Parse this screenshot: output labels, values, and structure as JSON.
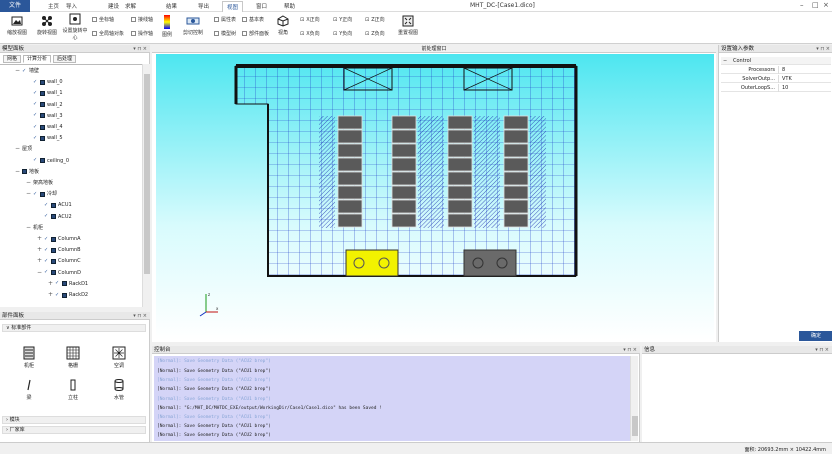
{
  "menu": {
    "file": "文件",
    "items": [
      "主页",
      "导入",
      "建设",
      "求解",
      "结果",
      "导出",
      "视图",
      "窗口",
      "帮助"
    ],
    "active_index": 6,
    "window_title": "MHT_DC-[Case1.dico]"
  },
  "ribbon": {
    "buttons": [
      "缩放视图",
      "旋转视图",
      "设置旋转中心",
      "图例",
      "剪切控制",
      "视角",
      "重置视图"
    ],
    "checks": [
      "坐标轴",
      "接线轴",
      "操作轴",
      "全局轴对象",
      "属性表",
      "基本表",
      "模型树",
      "部件面板"
    ],
    "views": [
      "X正向",
      "Y正向",
      "Z正向",
      "X负向",
      "Y负向",
      "Z负向"
    ]
  },
  "left_panel": {
    "title": "模型面板",
    "tabs": [
      "网格",
      "计算分析",
      "后处理"
    ],
    "tree": [
      {
        "label": "墙壁",
        "level": 1,
        "toggle": "−",
        "check": true,
        "icon": false
      },
      {
        "label": "wall_0",
        "level": 2,
        "toggle": "",
        "check": true,
        "icon": true
      },
      {
        "label": "wall_1",
        "level": 2,
        "toggle": "",
        "check": true,
        "icon": true
      },
      {
        "label": "wall_2",
        "level": 2,
        "toggle": "",
        "check": true,
        "icon": true
      },
      {
        "label": "wall_3",
        "level": 2,
        "toggle": "",
        "check": true,
        "icon": true
      },
      {
        "label": "wall_4",
        "level": 2,
        "toggle": "",
        "check": true,
        "icon": true
      },
      {
        "label": "wall_5",
        "level": 2,
        "toggle": "",
        "check": true,
        "icon": true
      },
      {
        "label": "屋顶",
        "level": 1,
        "toggle": "−",
        "check": false,
        "icon": false
      },
      {
        "label": "ceiling_0",
        "level": 2,
        "toggle": "",
        "check": true,
        "icon": true
      },
      {
        "label": "地板",
        "level": 1,
        "toggle": "−",
        "check": false,
        "icon": true
      },
      {
        "label": "架高地板",
        "level": 2,
        "toggle": "−",
        "check": false,
        "icon": false
      },
      {
        "label": "冷却",
        "level": 2,
        "toggle": "−",
        "check": true,
        "icon": true
      },
      {
        "label": "ACU1",
        "level": 3,
        "toggle": "",
        "check": true,
        "icon": true
      },
      {
        "label": "ACU2",
        "level": 3,
        "toggle": "",
        "check": true,
        "icon": true
      },
      {
        "label": "机柜",
        "level": 2,
        "toggle": "−",
        "check": false,
        "icon": false
      },
      {
        "label": "ColumnA",
        "level": 3,
        "toggle": "+",
        "check": true,
        "icon": true
      },
      {
        "label": "ColumnB",
        "level": 3,
        "toggle": "+",
        "check": true,
        "icon": true
      },
      {
        "label": "ColumnC",
        "level": 3,
        "toggle": "+",
        "check": true,
        "icon": true
      },
      {
        "label": "ColumnD",
        "level": 3,
        "toggle": "−",
        "check": true,
        "icon": true
      },
      {
        "label": "RackD1",
        "level": 4,
        "toggle": "+",
        "check": true,
        "icon": true
      },
      {
        "label": "RackD2",
        "level": 4,
        "toggle": "+",
        "check": true,
        "icon": true
      }
    ]
  },
  "part_panel": {
    "title": "部件面板",
    "section": "标准部件",
    "parts": [
      "机柜",
      "格栅",
      "空调",
      "梁",
      "立柱",
      "水管"
    ],
    "section2": "模块",
    "section3": "厂家库"
  },
  "viewport": {
    "title": "前处理窗口"
  },
  "right_panel": {
    "title": "设置输入参数",
    "group": "Control",
    "rows": [
      {
        "k": "Processors",
        "v": "8"
      },
      {
        "k": "SolverOutp...",
        "v": "VTK"
      },
      {
        "k": "OuterLoopS...",
        "v": "10"
      }
    ],
    "confirm": "确定"
  },
  "console": {
    "title": "控制台",
    "lines": [
      "[Normal]: Save Geometry Data (\"ACU1 brep\")",
      "[Normal]: Save Geometry Data (\"ACU2 brep\")",
      "[Normal]: \"G:/MHT_DC/MHTDC_EXE/output/WorkingDir/Case1/Case1.dico\" has been Saved !",
      "[Normal]: Save Geometry Data (\"ACU1 brep\")",
      "[Normal]: Save Geometry Data (\"ACU2 brep\")"
    ]
  },
  "info_panel": {
    "title": "信息"
  },
  "status": {
    "text": "面积: 20693.2mm × 10422.4mm"
  },
  "colors": {
    "accent": "#2b579a",
    "canvas_top": "#4de6f0",
    "grid": "#1e3cc8",
    "acu": "#f2f200",
    "cabinet": "#5a5a5a"
  }
}
